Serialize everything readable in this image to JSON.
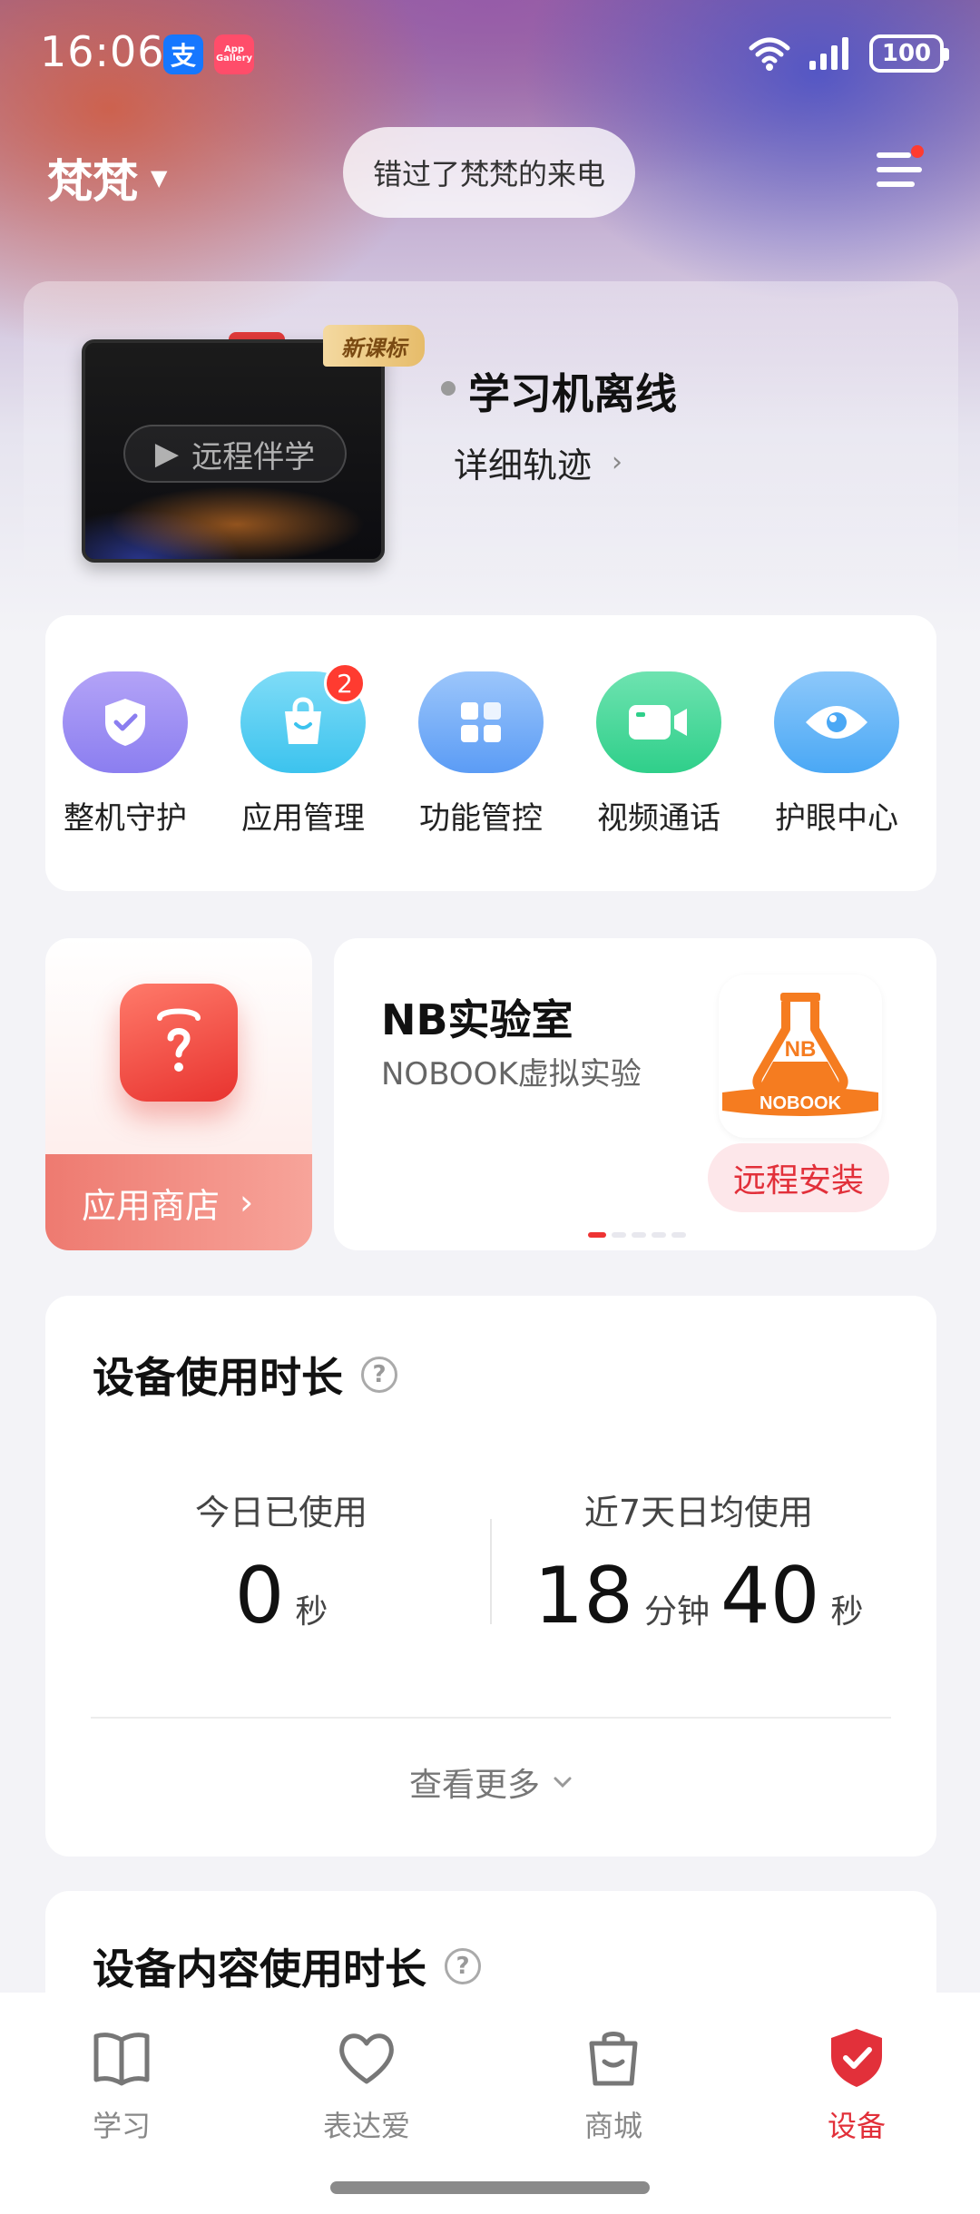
{
  "status_bar": {
    "time": "16:06",
    "alipay_icon": "支",
    "app_gallery_icon": "App Gallery",
    "battery": "100"
  },
  "header": {
    "user_name": "梵梵",
    "missed_call": "错过了梵梵的来电"
  },
  "device": {
    "badge": "新课标",
    "remote_label": "远程伴学",
    "status": "学习机离线",
    "track_link": "详细轨迹"
  },
  "actions": [
    {
      "label": "整机守护",
      "icon": "shield-check-icon",
      "color": "#8b7ef0"
    },
    {
      "label": "应用管理",
      "icon": "shopping-bag-icon",
      "color": "#3cc3ee",
      "badge": "2"
    },
    {
      "label": "功能管控",
      "icon": "grid-icon",
      "color": "#5b9cf5"
    },
    {
      "label": "视频通话",
      "icon": "video-camera-icon",
      "color": "#2fcf8a"
    },
    {
      "label": "护眼中心",
      "icon": "eye-icon",
      "color": "#4aa8f5"
    }
  ],
  "app_store": {
    "label": "应用商店"
  },
  "promo": {
    "title": "NB实验室",
    "subtitle": "NOBOOK虚拟实验",
    "logo_text": "NB",
    "logo_caption": "NOBOOK",
    "install": "远程安装"
  },
  "usage": {
    "title": "设备使用时长",
    "today_label": "今日已使用",
    "today_value": "0",
    "today_unit": "秒",
    "avg_label": "近7天日均使用",
    "avg_minutes": "18",
    "avg_minutes_unit": "分钟",
    "avg_seconds": "40",
    "avg_seconds_unit": "秒",
    "view_more": "查看更多"
  },
  "content_usage": {
    "title": "设备内容使用时长"
  },
  "bottom_nav": [
    {
      "label": "学习",
      "icon": "book-icon"
    },
    {
      "label": "表达爱",
      "icon": "heart-icon"
    },
    {
      "label": "商城",
      "icon": "shopping-bag-icon"
    },
    {
      "label": "设备",
      "icon": "device-shield-icon",
      "active": true
    }
  ],
  "colors": {
    "accent": "#e2303a",
    "missed_call_bg": "#ffffffc7"
  }
}
